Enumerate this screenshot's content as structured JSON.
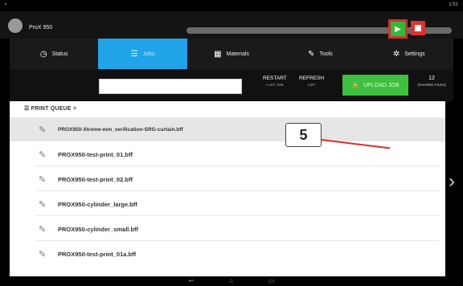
{
  "app": {
    "title": "ProX 950",
    "status_time": "1:51"
  },
  "tabs": [
    {
      "label": "Status",
      "icon": "clock-icon"
    },
    {
      "label": "Jobs",
      "icon": "list-icon"
    },
    {
      "label": "Materials",
      "icon": "materials-icon"
    },
    {
      "label": "Tools",
      "icon": "wrench-icon"
    },
    {
      "label": "Settings",
      "icon": "gear-icon"
    }
  ],
  "toolbar": {
    "search_placeholder": "",
    "restart_label": "RESTART",
    "restart_sub": "LAST JOB",
    "refresh_label": "REFRESH",
    "refresh_sub": "LIST",
    "upload_label": "UPLOAD JOB",
    "count": "12",
    "count_sub": "(SHARED FILES)"
  },
  "queue": {
    "heading": "PRINT QUEUE >",
    "files": [
      "PROX950-Xtreme-mm_verification-SRG-curtain.bff",
      "PROX950-test-print_01.bff",
      "PROX950-test-print_02.bff",
      "PROX950-cylinder_large.bff",
      "PROX950-cylinder_small.bff",
      "PROX950-test-print_01a.bff"
    ]
  },
  "callout": {
    "number": "5"
  },
  "colors": {
    "accent": "#22a4ea",
    "play": "#2dbd3a",
    "stop": "#e23030",
    "callout_line": "#d63030"
  }
}
